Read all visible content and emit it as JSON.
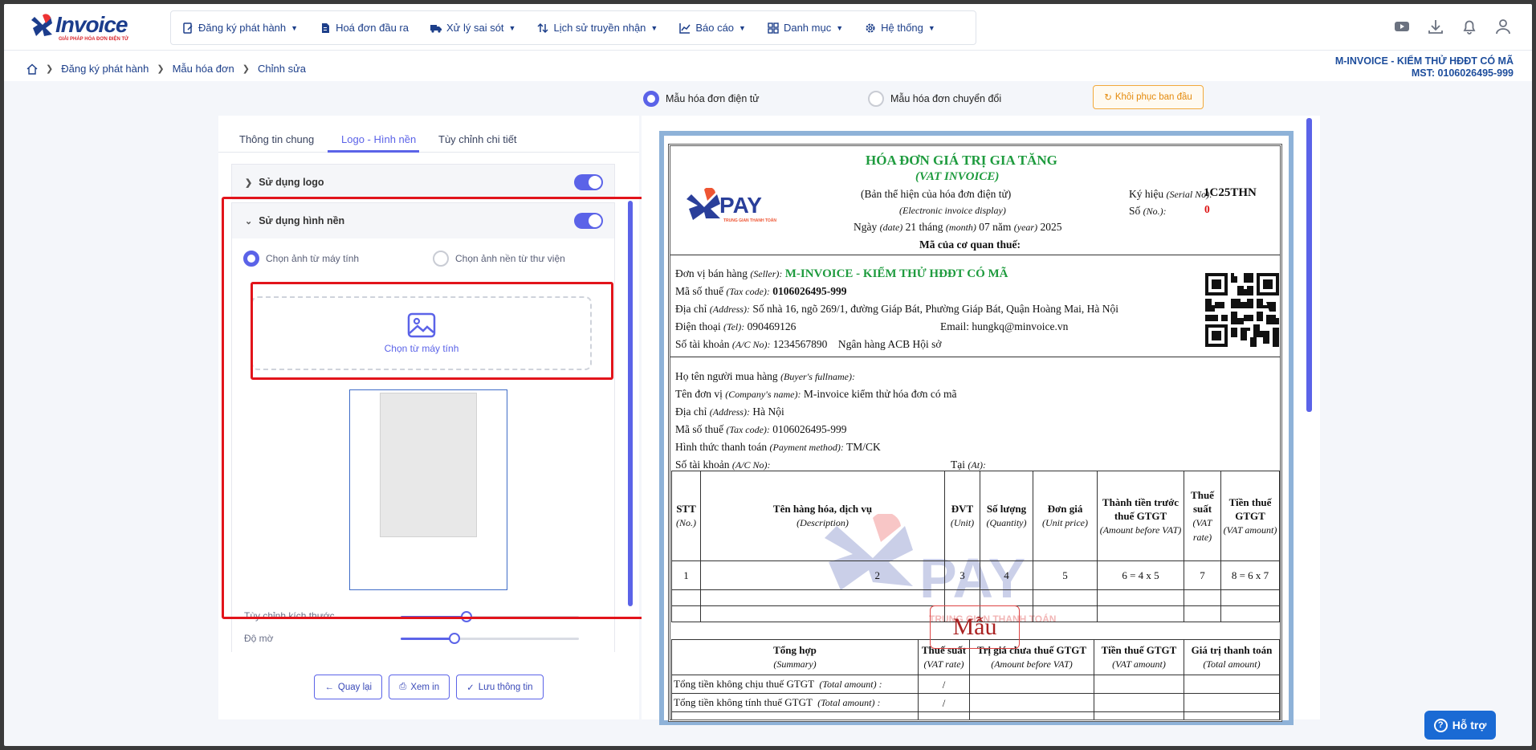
{
  "app": {
    "logo_text": "Invoice",
    "logo_tagline": "GIẢI PHÁP HÓA ĐƠN ĐIỆN TỬ"
  },
  "menu": [
    {
      "label": "Đăng ký phát hành",
      "icon": "document-register-icon",
      "has_dropdown": true
    },
    {
      "label": "Hoá đơn đầu ra",
      "icon": "invoice-file-icon",
      "has_dropdown": false
    },
    {
      "label": "Xử lý sai sót",
      "icon": "truck-icon",
      "has_dropdown": true
    },
    {
      "label": "Lịch sử truyền nhận",
      "icon": "transfer-arrows-icon",
      "has_dropdown": true
    },
    {
      "label": "Báo cáo",
      "icon": "chart-icon",
      "has_dropdown": true
    },
    {
      "label": "Danh mục",
      "icon": "grid-icon",
      "has_dropdown": true
    },
    {
      "label": "Hệ thống",
      "icon": "gear-icon",
      "has_dropdown": true
    }
  ],
  "top_icons": [
    "youtube-icon",
    "download-icon",
    "bell-icon",
    "user-icon"
  ],
  "breadcrumb": [
    "Đăng ký phát hành",
    "Mẫu hóa đơn",
    "Chỉnh sửa"
  ],
  "company": {
    "name": "M-INVOICE - KIỂM THỬ HĐĐT CÓ MÃ",
    "tax": "MST: 0106026495-999"
  },
  "template_type": {
    "option1": "Mẫu hóa đơn điện tử",
    "option2": "Mẫu hóa đơn chuyển đổi",
    "selected": "option1",
    "restore_label": "Khôi phục ban đầu"
  },
  "tabs": [
    "Thông tin chung",
    "Logo - Hình nền",
    "Tùy chỉnh chi tiết"
  ],
  "active_tab": "Logo - Hình nền",
  "logo_section": {
    "title": "Sử dụng logo",
    "enabled": true
  },
  "background_section": {
    "title": "Sử dụng hình nền",
    "enabled": true,
    "source_option1": "Chọn ảnh từ máy tính",
    "source_option2": "Chọn ảnh nền từ thư viện",
    "upload_label": "Chọn từ máy tính",
    "size_label": "Tùy chỉnh kích thước",
    "size_value": 0.37,
    "opacity_label": "Độ mờ",
    "opacity_value": 0.3
  },
  "actions": {
    "back": "Quay lại",
    "preview": "Xem in",
    "save": "Lưu thông tin"
  },
  "invoice": {
    "title": "HÓA ĐƠN GIÁ TRỊ GIA TĂNG",
    "subtitle": "(VAT INVOICE)",
    "display_vi": "(Bản thể hiện của hóa đơn điện tử)",
    "display_en": "(Electronic invoice display)",
    "date_line_1": "Ngày ",
    "date_i1": "(date)",
    "date_line_2": " 21 tháng ",
    "date_i2": "(month)",
    "date_line_3": " 07 năm ",
    "date_i3": "(year)",
    "date_line_4": " 2025",
    "tax_authority_code": "Mã của cơ quan thuế:",
    "serial_label": "Ký hiệu",
    "serial_i": "(Serial No):",
    "serial_value": "1C25THN",
    "number_label": "Số",
    "number_i": "(No.):",
    "number_value": "0",
    "logo_brand": "PAY",
    "logo_tag": "TRUNG GIAN THANH TOÁN",
    "seller_label": "Đơn vị bán hàng",
    "seller_i": "(Seller):",
    "seller_name": "M-INVOICE - KIỂM THỬ HĐĐT CÓ MÃ",
    "seller_tax_label": "Mã số thuế",
    "seller_tax_i": "(Tax code):",
    "seller_tax": "0106026495-999",
    "seller_addr_label": "Địa chỉ",
    "seller_addr_i": "(Address):",
    "seller_addr": "Số nhà 16, ngõ 269/1, đường Giáp Bát, Phường Giáp Bát, Quận Hoàng Mai, Hà Nội",
    "seller_tel_label": "Điện thoại",
    "seller_tel_i": "(Tel):",
    "seller_tel": "090469126",
    "seller_email_label": "Email:",
    "seller_email": "hungkq@minvoice.vn",
    "seller_acc_label": "Số tài khoản",
    "seller_acc_i": "(A/C No):",
    "seller_acc": "1234567890",
    "seller_bank": "Ngân hàng ACB Hội sở",
    "buyer_name_label": "Họ tên người mua hàng",
    "buyer_name_i": "(Buyer's fullname):",
    "buyer_company_label": "Tên đơn vị",
    "buyer_company_i": "(Company's name):",
    "buyer_company": "M-invoice kiểm thử hóa đơn có mã",
    "buyer_addr_label": "Địa chỉ",
    "buyer_addr_i": "(Address):",
    "buyer_addr": "Hà Nội",
    "buyer_tax_label": "Mã số thuế",
    "buyer_tax_i": "(Tax code):",
    "buyer_tax": "0106026495-999",
    "payment_label": "Hình thức thanh toán",
    "payment_i": "(Payment method):",
    "payment": "TM/CK",
    "buyer_acc_label": "Số tài khoản",
    "buyer_acc_i": "(A/C No):",
    "at_label": "Tại",
    "at_i": "(At):",
    "table_headers": [
      {
        "vi": "STT",
        "en": "(No.)"
      },
      {
        "vi": "Tên hàng hóa, dịch vụ",
        "en": "(Description)"
      },
      {
        "vi": "ĐVT",
        "en": "(Unit)"
      },
      {
        "vi": "Số lượng",
        "en": "(Quantity)"
      },
      {
        "vi": "Đơn giá",
        "en": "(Unit price)"
      },
      {
        "vi": "Thành tiền trước thuế GTGT",
        "en": "(Amount before VAT)"
      },
      {
        "vi": "Thuế suất",
        "en": "(VAT rate)"
      },
      {
        "vi": "Tiền thuế GTGT",
        "en": "(VAT amount)"
      }
    ],
    "table_index_row": [
      "1",
      "2",
      "3",
      "4",
      "5",
      "6 = 4 x 5",
      "7",
      "8 = 6 x 7"
    ],
    "summary_headers": [
      {
        "vi": "Tổng hợp",
        "en": "(Summary)"
      },
      {
        "vi": "Thuế suất",
        "en": "(VAT rate)"
      },
      {
        "vi": "Trị giá chưa thuế GTGT",
        "en": "(Amount before VAT)"
      },
      {
        "vi": "Tiền thuế GTGT",
        "en": "(VAT amount)"
      },
      {
        "vi": "Giá trị thanh toán",
        "en": "(Total amount)"
      }
    ],
    "summary_rows": [
      {
        "vi": "Tổng tiền không chịu thuế GTGT",
        "en": "(Total amount) :",
        "rate": "/"
      },
      {
        "vi": "Tổng tiền không tính thuế GTGT",
        "en": "(Total amount) :",
        "rate": "/"
      }
    ],
    "watermark_text": "Mẫu",
    "bg_brand": "PAY",
    "bg_tag": "TRUNG GIAN THANH TOÁN"
  },
  "help": {
    "label": "Hỗ trợ"
  }
}
